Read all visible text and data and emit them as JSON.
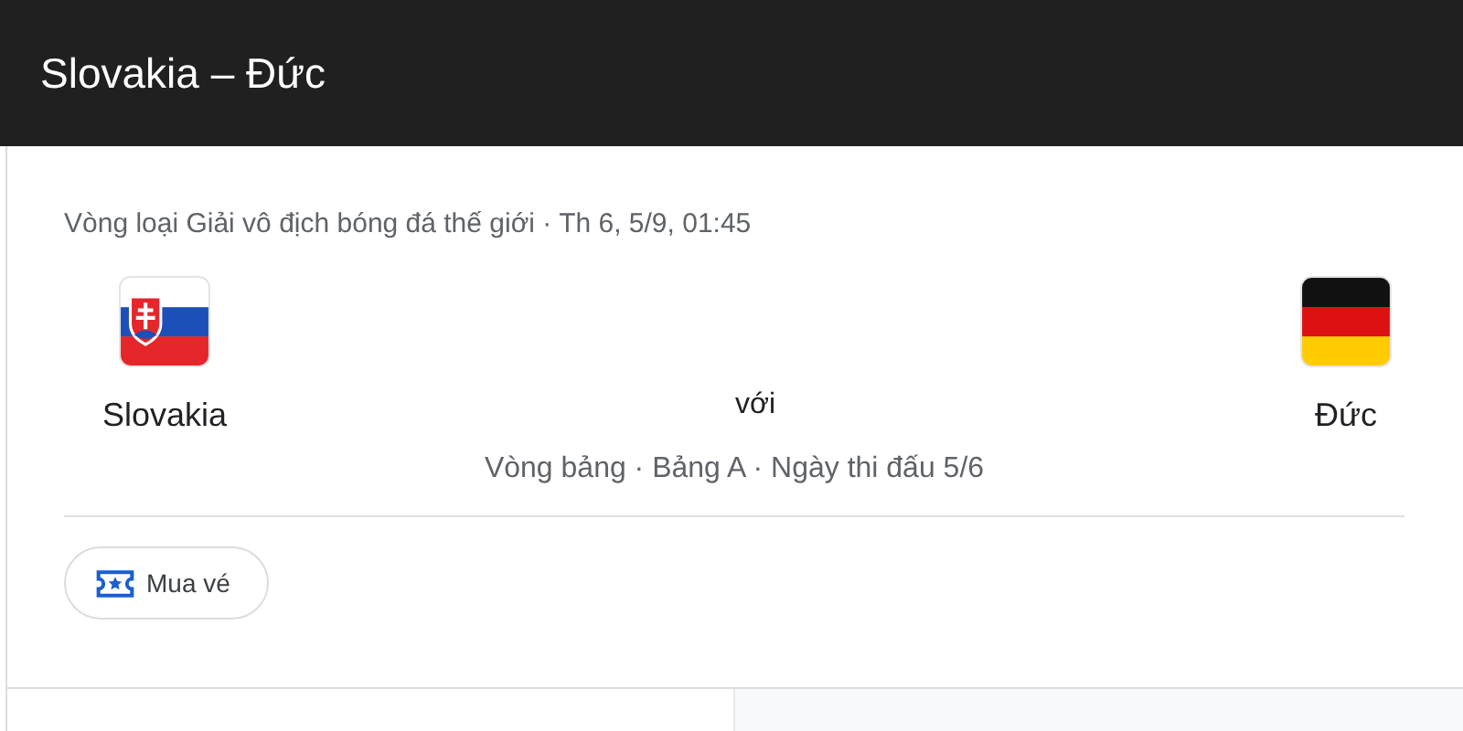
{
  "header": {
    "title": "Slovakia – Đức"
  },
  "match": {
    "competition": "Vòng loại Giải vô địch bóng đá thế giới · Th 6, 5/9, 01:45",
    "teams": [
      {
        "name": "Slovakia",
        "kind": "slovakia"
      },
      {
        "name": "Đức",
        "kind": "germany"
      }
    ],
    "versus": "với",
    "stage": "Vòng bảng · Bảng A · Ngày thi đấu 5/6"
  },
  "actions": [
    {
      "label": "Mua vé"
    }
  ]
}
